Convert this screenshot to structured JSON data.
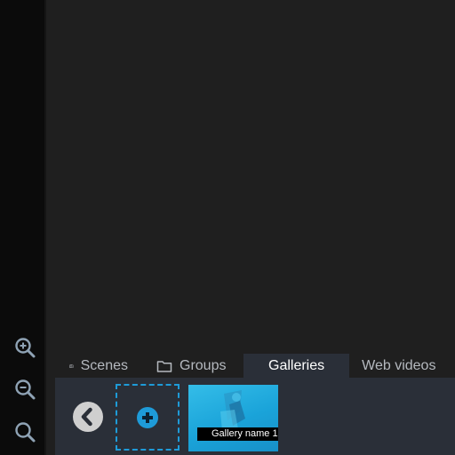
{
  "zoom_controls": {
    "zoom_in_icon": "zoom-in-icon",
    "zoom_out_icon": "zoom-out-icon",
    "zoom_fit_icon": "zoom-fit-icon"
  },
  "tabs": [
    {
      "label": "Scenes",
      "icon": "tv-icon"
    },
    {
      "label": "Groups",
      "icon": "folder-icon"
    },
    {
      "label": "Galleries",
      "active": true
    },
    {
      "label": "Web videos"
    }
  ],
  "panel": {
    "back_icon": "chevron-left-icon",
    "add_icon": "plus-circle-icon",
    "galleries": [
      {
        "name": "Gallery name 1"
      }
    ]
  },
  "colors": {
    "accent": "#1e9bd8",
    "panel_bg": "#2a2f38",
    "rail_bg": "#0b0b0b"
  }
}
